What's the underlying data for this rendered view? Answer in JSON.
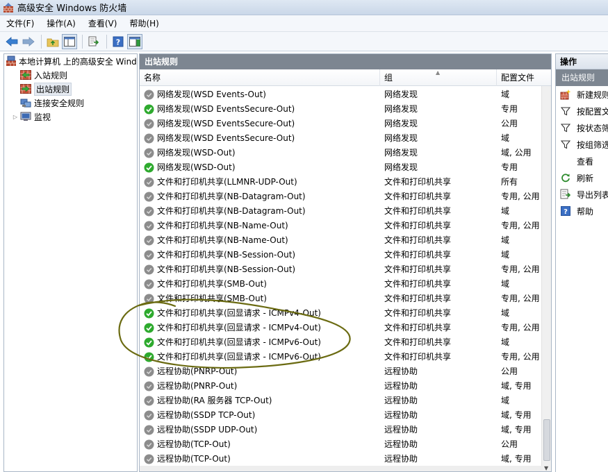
{
  "window": {
    "title": "高级安全 Windows 防火墙"
  },
  "menu": [
    {
      "label": "文件(F)"
    },
    {
      "label": "操作(A)"
    },
    {
      "label": "查看(V)"
    },
    {
      "label": "帮助(H)"
    }
  ],
  "tree": {
    "root": "本地计算机 上的高级安全 Windows",
    "items": [
      {
        "label": "入站规则"
      },
      {
        "label": "出站规则"
      },
      {
        "label": "连接安全规则"
      },
      {
        "label": "监视"
      }
    ]
  },
  "center": {
    "header": "出站规则",
    "columns": {
      "name": "名称",
      "group": "组",
      "profile": "配置文件"
    },
    "rows": [
      {
        "enabled": false,
        "name": "网络发现(WSD Events-Out)",
        "group": "网络发现",
        "profile": "域"
      },
      {
        "enabled": true,
        "name": "网络发现(WSD EventsSecure-Out)",
        "group": "网络发现",
        "profile": "专用"
      },
      {
        "enabled": false,
        "name": "网络发现(WSD EventsSecure-Out)",
        "group": "网络发现",
        "profile": "公用"
      },
      {
        "enabled": false,
        "name": "网络发现(WSD EventsSecure-Out)",
        "group": "网络发现",
        "profile": "域"
      },
      {
        "enabled": false,
        "name": "网络发现(WSD-Out)",
        "group": "网络发现",
        "profile": "域, 公用"
      },
      {
        "enabled": true,
        "name": "网络发现(WSD-Out)",
        "group": "网络发现",
        "profile": "专用"
      },
      {
        "enabled": false,
        "name": "文件和打印机共享(LLMNR-UDP-Out)",
        "group": "文件和打印机共享",
        "profile": "所有"
      },
      {
        "enabled": false,
        "name": "文件和打印机共享(NB-Datagram-Out)",
        "group": "文件和打印机共享",
        "profile": "专用, 公用"
      },
      {
        "enabled": false,
        "name": "文件和打印机共享(NB-Datagram-Out)",
        "group": "文件和打印机共享",
        "profile": "域"
      },
      {
        "enabled": false,
        "name": "文件和打印机共享(NB-Name-Out)",
        "group": "文件和打印机共享",
        "profile": "专用, 公用"
      },
      {
        "enabled": false,
        "name": "文件和打印机共享(NB-Name-Out)",
        "group": "文件和打印机共享",
        "profile": "域"
      },
      {
        "enabled": false,
        "name": "文件和打印机共享(NB-Session-Out)",
        "group": "文件和打印机共享",
        "profile": "域"
      },
      {
        "enabled": false,
        "name": "文件和打印机共享(NB-Session-Out)",
        "group": "文件和打印机共享",
        "profile": "专用, 公用"
      },
      {
        "enabled": false,
        "name": "文件和打印机共享(SMB-Out)",
        "group": "文件和打印机共享",
        "profile": "域"
      },
      {
        "enabled": false,
        "name": "文件和打印机共享(SMB-Out)",
        "group": "文件和打印机共享",
        "profile": "专用, 公用"
      },
      {
        "enabled": true,
        "name": "文件和打印机共享(回显请求 - ICMPv4-Out)",
        "group": "文件和打印机共享",
        "profile": "域"
      },
      {
        "enabled": true,
        "name": "文件和打印机共享(回显请求 - ICMPv4-Out)",
        "group": "文件和打印机共享",
        "profile": "专用, 公用"
      },
      {
        "enabled": true,
        "name": "文件和打印机共享(回显请求 - ICMPv6-Out)",
        "group": "文件和打印机共享",
        "profile": "域"
      },
      {
        "enabled": true,
        "name": "文件和打印机共享(回显请求 - ICMPv6-Out)",
        "group": "文件和打印机共享",
        "profile": "专用, 公用"
      },
      {
        "enabled": false,
        "name": "远程协助(PNRP-Out)",
        "group": "远程协助",
        "profile": "公用"
      },
      {
        "enabled": false,
        "name": "远程协助(PNRP-Out)",
        "group": "远程协助",
        "profile": "域, 专用"
      },
      {
        "enabled": false,
        "name": "远程协助(RA 服务器 TCP-Out)",
        "group": "远程协助",
        "profile": "域"
      },
      {
        "enabled": false,
        "name": "远程协助(SSDP TCP-Out)",
        "group": "远程协助",
        "profile": "域, 专用"
      },
      {
        "enabled": false,
        "name": "远程协助(SSDP UDP-Out)",
        "group": "远程协助",
        "profile": "域, 专用"
      },
      {
        "enabled": false,
        "name": "远程协助(TCP-Out)",
        "group": "远程协助",
        "profile": "公用"
      },
      {
        "enabled": false,
        "name": "远程协助(TCP-Out)",
        "group": "远程协助",
        "profile": "域, 专用"
      }
    ]
  },
  "actions": {
    "title": "操作",
    "section": "出站规则",
    "items": [
      {
        "label": "新建规则...",
        "icon": "new-rule-icon"
      },
      {
        "label": "按配置文件筛选",
        "icon": "filter-icon"
      },
      {
        "label": "按状态筛选",
        "icon": "filter-icon"
      },
      {
        "label": "按组筛选",
        "icon": "filter-icon"
      },
      {
        "label": "查看",
        "icon": "none"
      },
      {
        "label": "刷新",
        "icon": "refresh-icon"
      },
      {
        "label": "导出列表...",
        "icon": "export-icon"
      },
      {
        "label": "帮助",
        "icon": "help-icon"
      }
    ]
  },
  "colors": {
    "enabled": "#2eaa2e",
    "disabled": "#8c8c8c",
    "header": "#7d8691",
    "annotation": "#6b6b12"
  }
}
